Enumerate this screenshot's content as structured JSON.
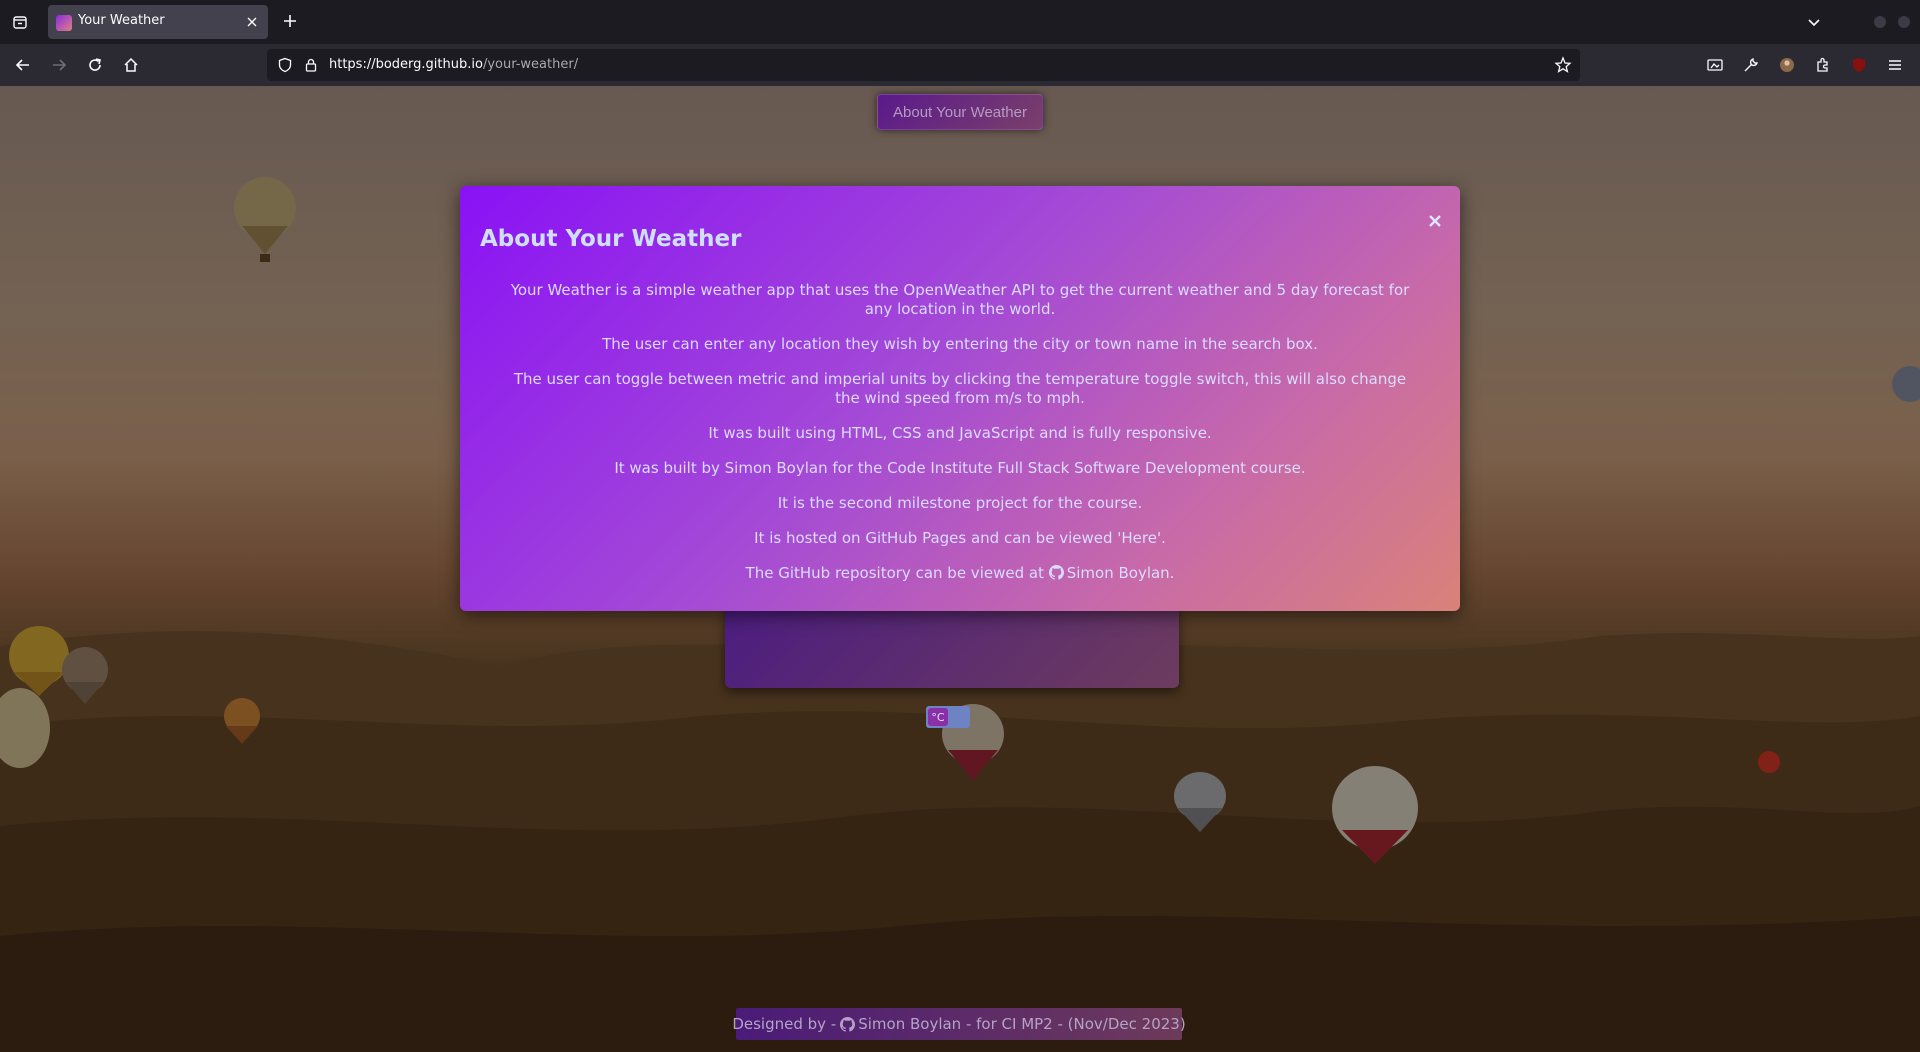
{
  "browser": {
    "tab_title": "Your Weather",
    "url_host": "https://boderg.github.io",
    "url_path": "/your-weather/"
  },
  "page": {
    "about_button": "About Your Weather",
    "toggle_label": "°C",
    "footer_prefix": "Designed by - ",
    "footer_name": "Simon Boylan",
    "footer_suffix": " - for CI MP2 - (Nov/Dec 2023)"
  },
  "modal": {
    "title": "About Your Weather",
    "paragraphs": [
      "Your Weather is a simple weather app that uses the OpenWeather API to get the current weather and 5 day forecast for any location in the world.",
      "The user can enter any location they wish by entering the city or town name in the search box.",
      "The user can toggle between metric and imperial units by clicking the temperature toggle switch, this will also change the wind speed from m/s to mph.",
      "It was built using HTML, CSS and JavaScript and is fully responsive.",
      "It was built by Simon Boylan for the Code Institute Full Stack Software Development course.",
      "It is the second milestone project for the course.",
      "It is hosted on GitHub Pages and can be viewed 'Here'."
    ],
    "repo_prefix": "The GitHub repository can be viewed at ",
    "repo_name": "Simon Boylan."
  },
  "colors": {
    "modal_gradient_start": "#8a12f5",
    "modal_gradient_end": "#d98279",
    "title_color": "#cfe0ff"
  }
}
